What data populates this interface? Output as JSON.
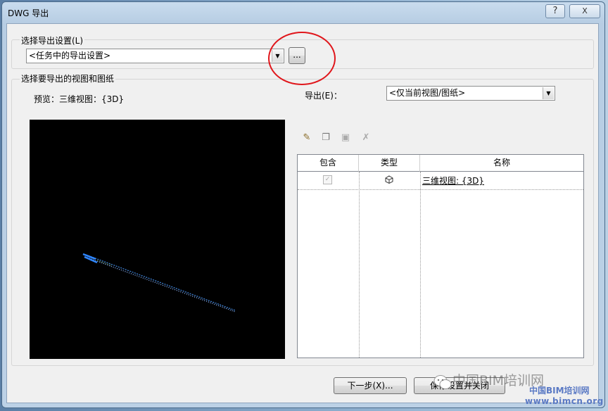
{
  "window": {
    "title": "DWG 导出",
    "help_label": "?",
    "close_label": "X"
  },
  "export_settings": {
    "group_label": "选择导出设置(L)",
    "selected": "<任务中的导出设置>",
    "browse_label": "..."
  },
  "views": {
    "group_label": "选择要导出的视图和图纸",
    "preview_label": "预览：三维视图：{3D}",
    "export_label": "导出(E)：",
    "export_selected": "<仅当前视图/图纸>",
    "table": {
      "columns": [
        "包含",
        "类型",
        "名称"
      ],
      "rows": [
        {
          "include": "✓",
          "type_icon": "3d-view-icon",
          "name": "三维视图: {3D}"
        }
      ]
    },
    "toolbar_icons": [
      "new-set-icon",
      "duplicate-icon",
      "rename-icon",
      "delete-icon"
    ]
  },
  "footer": {
    "next_label": "下一步(X)...",
    "save_close_label": "保存设置并关闭"
  },
  "watermark": {
    "line1": "中国BIM培训网",
    "line2": "中国BIM培训网",
    "line3": "www.bimcn.org"
  },
  "colors": {
    "annotation_circle": "#e0161b",
    "preview_background": "#000000"
  }
}
